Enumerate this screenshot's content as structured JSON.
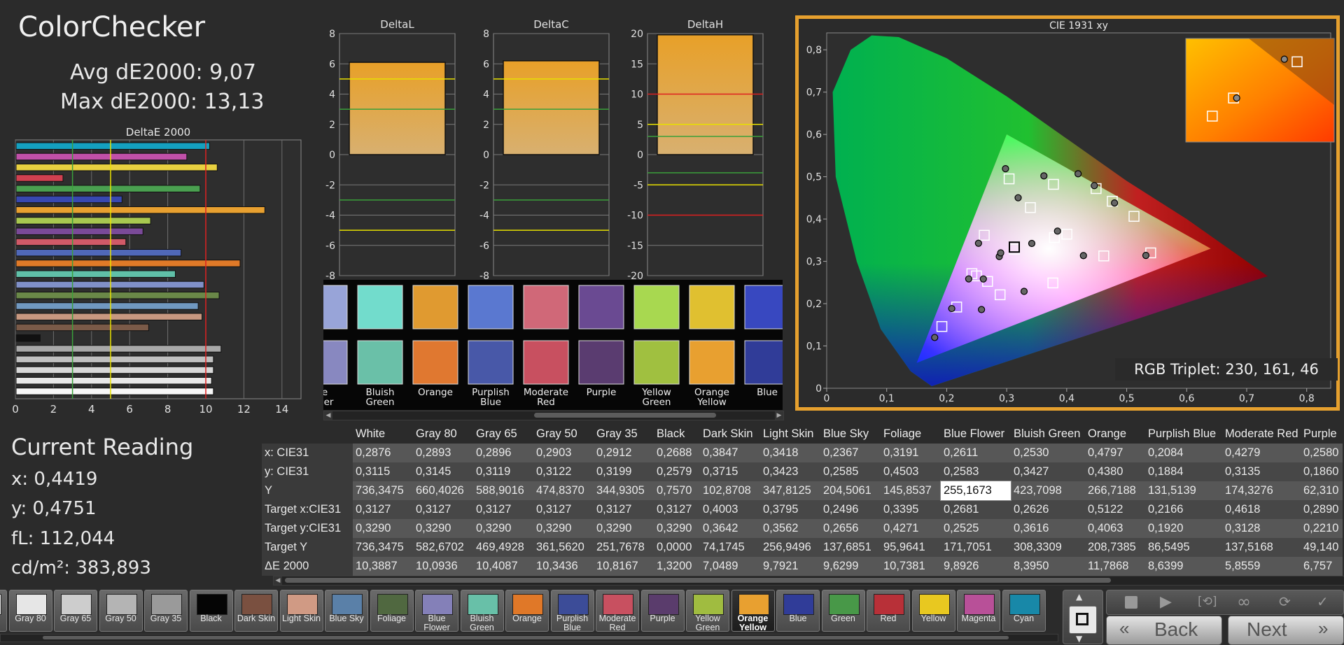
{
  "header": {
    "title": "ColorChecker",
    "avg_label": "Avg dE2000:",
    "avg_value": "9,07",
    "max_label": "Max dE2000:",
    "max_value": "13,13"
  },
  "current_reading": {
    "title": "Current Reading",
    "x_label": "x:",
    "x": "0,4419",
    "y_label": "y:",
    "y": "0,4751",
    "fl_label": "fL:",
    "fl": "112,044",
    "cd_label": "cd/m²:",
    "cd": "383,893"
  },
  "colors": {
    "accent": "#e6a02e",
    "panel": "#2b2b2b",
    "grid_line": "#777777",
    "green_line": "#3aa03a",
    "yellow_line": "#e8e000",
    "red_line": "#dd2020"
  },
  "deltae_chart": {
    "title": "DeltaE 2000",
    "x_ticks": [
      "0",
      "2",
      "4",
      "6",
      "8",
      "10",
      "12",
      "14"
    ],
    "xlim": [
      0,
      15
    ],
    "threshold_lines": [
      3,
      5,
      10
    ],
    "bars": [
      {
        "value": 10.2,
        "color": "#14a0c0"
      },
      {
        "value": 9.0,
        "color": "#c050a8"
      },
      {
        "value": 10.6,
        "color": "#e8d040"
      },
      {
        "value": 2.5,
        "color": "#d04050"
      },
      {
        "value": 9.7,
        "color": "#4aa050"
      },
      {
        "value": 5.6,
        "color": "#3848b0"
      },
      {
        "value": 13.1,
        "color": "#e8a030"
      },
      {
        "value": 7.1,
        "color": "#a8c850"
      },
      {
        "value": 6.7,
        "color": "#7a4a98"
      },
      {
        "value": 5.8,
        "color": "#d05a68"
      },
      {
        "value": 8.7,
        "color": "#5068b8"
      },
      {
        "value": 11.8,
        "color": "#e07a28"
      },
      {
        "value": 8.4,
        "color": "#60c0a8"
      },
      {
        "value": 9.9,
        "color": "#8090c8"
      },
      {
        "value": 10.7,
        "color": "#6a8848"
      },
      {
        "value": 9.6,
        "color": "#7098c0"
      },
      {
        "value": 9.8,
        "color": "#c89880"
      },
      {
        "value": 7.0,
        "color": "#7a5a48"
      },
      {
        "value": 1.3,
        "color": "#111111"
      },
      {
        "value": 10.8,
        "color": "#a8a8a8"
      },
      {
        "value": 10.4,
        "color": "#c0c0c0"
      },
      {
        "value": 10.4,
        "color": "#d8d8d8"
      },
      {
        "value": 10.3,
        "color": "#e8e8e8"
      },
      {
        "value": 10.4,
        "color": "#f8f8f8"
      }
    ]
  },
  "delta_charts": [
    {
      "title": "DeltaL",
      "ticks": [
        "8",
        "6",
        "4",
        "2",
        "0",
        "-2",
        "-4",
        "-6",
        "-8"
      ],
      "ylim": [
        -8,
        8
      ],
      "value": 6.1,
      "lines": [
        {
          "v": 5,
          "c": "yellow"
        },
        {
          "v": 3,
          "c": "green"
        },
        {
          "v": -3,
          "c": "green"
        },
        {
          "v": -5,
          "c": "yellow"
        }
      ]
    },
    {
      "title": "DeltaC",
      "ticks": [
        "8",
        "6",
        "4",
        "2",
        "0",
        "-2",
        "-4",
        "-6",
        "-8"
      ],
      "ylim": [
        -8,
        8
      ],
      "value": 6.2,
      "lines": [
        {
          "v": 5,
          "c": "yellow"
        },
        {
          "v": 3,
          "c": "green"
        },
        {
          "v": -3,
          "c": "green"
        },
        {
          "v": -5,
          "c": "yellow"
        }
      ]
    },
    {
      "title": "DeltaH",
      "ticks": [
        "20",
        "15",
        "10",
        "5",
        "0",
        "-5",
        "-10",
        "-15",
        "-20"
      ],
      "ylim": [
        -20,
        20
      ],
      "value": 19.8,
      "lines": [
        {
          "v": 10,
          "c": "red"
        },
        {
          "v": 5,
          "c": "yellow"
        },
        {
          "v": 3,
          "c": "green"
        },
        {
          "v": -3,
          "c": "green"
        },
        {
          "v": -5,
          "c": "yellow"
        },
        {
          "v": -10,
          "c": "red"
        }
      ]
    }
  ],
  "swatch_panel": {
    "labels": [
      "e\nwer",
      "Bluish\nGreen",
      "Orange",
      "Purplish\nBlue",
      "Moderate\nRed",
      "Purple",
      "Yellow\nGreen",
      "Orange\nYellow",
      "Blue"
    ],
    "measured": [
      "#98a4d8",
      "#72dccc",
      "#e09a30",
      "#5a78d0",
      "#d06878",
      "#6a4a92",
      "#a8d850",
      "#e0c030",
      "#3848c0"
    ],
    "target": [
      "#8888c0",
      "#6ac0a8",
      "#e07830",
      "#4858a8",
      "#c85060",
      "#5a3c70",
      "#a0c040",
      "#e8a030",
      "#303c98"
    ]
  },
  "cie_chart": {
    "title": "CIE 1931 xy",
    "x_ticks": [
      "0",
      "0,1",
      "0,2",
      "0,3",
      "0,4",
      "0,5",
      "0,6",
      "0,7",
      "0,8"
    ],
    "y_ticks": [
      "0",
      "0,1",
      "0,2",
      "0,3",
      "0,4",
      "0,5",
      "0,6",
      "0,7",
      "0,8"
    ],
    "xlim": [
      0,
      0.84
    ],
    "ylim": [
      0,
      0.84
    ],
    "gamut_triangle": [
      [
        0.64,
        0.33
      ],
      [
        0.3,
        0.6
      ],
      [
        0.15,
        0.06
      ]
    ],
    "targets": [
      [
        0.3127,
        0.329
      ],
      [
        0.4003,
        0.3642
      ],
      [
        0.3795,
        0.3562
      ],
      [
        0.2496,
        0.2656
      ],
      [
        0.3395,
        0.4271
      ],
      [
        0.2681,
        0.2525
      ],
      [
        0.2626,
        0.3616
      ],
      [
        0.5122,
        0.4063
      ],
      [
        0.2166,
        0.192
      ],
      [
        0.4618,
        0.3128
      ],
      [
        0.289,
        0.221
      ],
      [
        0.378,
        0.482
      ],
      [
        0.476,
        0.442
      ],
      [
        0.192,
        0.146
      ],
      [
        0.304,
        0.495
      ],
      [
        0.54,
        0.32
      ],
      [
        0.449,
        0.472
      ],
      [
        0.377,
        0.249
      ],
      [
        0.242,
        0.271
      ]
    ],
    "measured": [
      [
        0.2876,
        0.3115
      ],
      [
        0.3847,
        0.3715
      ],
      [
        0.3418,
        0.3423
      ],
      [
        0.2367,
        0.2585
      ],
      [
        0.3191,
        0.4503
      ],
      [
        0.2611,
        0.2583
      ],
      [
        0.253,
        0.3427
      ],
      [
        0.4797,
        0.438
      ],
      [
        0.2084,
        0.1884
      ],
      [
        0.4279,
        0.3135
      ],
      [
        0.258,
        0.186
      ],
      [
        0.362,
        0.502
      ],
      [
        0.446,
        0.479
      ],
      [
        0.18,
        0.12
      ],
      [
        0.298,
        0.519
      ],
      [
        0.532,
        0.314
      ],
      [
        0.419,
        0.507
      ],
      [
        0.329,
        0.229
      ],
      [
        0.29,
        0.32
      ]
    ],
    "current": [
      0.3127,
      0.3336
    ],
    "inset_targets": [
      [
        0.585,
        0.812
      ],
      [
        0.525,
        0.784
      ],
      [
        0.505,
        0.77
      ]
    ],
    "inset_measured": [
      [
        0.573,
        0.814
      ],
      [
        0.528,
        0.784
      ]
    ]
  },
  "rgb_triplet": {
    "label": "RGB Triplet:",
    "value": "230, 161, 46"
  },
  "table": {
    "row_header_blank": "",
    "columns": [
      "White",
      "Gray 80",
      "Gray 65",
      "Gray 50",
      "Gray 35",
      "Black",
      "Dark Skin",
      "Light Skin",
      "Blue Sky",
      "Foliage",
      "Blue Flower",
      "Bluish Green",
      "Orange",
      "Purplish Blue",
      "Moderate Red",
      "Purple"
    ],
    "rows": [
      {
        "label": "x: CIE31",
        "cells": [
          "0,2876",
          "0,2893",
          "0,2896",
          "0,2903",
          "0,2912",
          "0,2688",
          "0,3847",
          "0,3418",
          "0,2367",
          "0,3191",
          "0,2611",
          "0,2530",
          "0,4797",
          "0,2084",
          "0,4279",
          "0,2580"
        ]
      },
      {
        "label": "y: CIE31",
        "cells": [
          "0,3115",
          "0,3145",
          "0,3119",
          "0,3122",
          "0,3199",
          "0,2579",
          "0,3715",
          "0,3423",
          "0,2585",
          "0,4503",
          "0,2583",
          "0,3427",
          "0,4380",
          "0,1884",
          "0,3135",
          "0,1860"
        ]
      },
      {
        "label": "Y",
        "cells": [
          "736,3475",
          "660,4026",
          "588,9016",
          "474,8370",
          "344,9305",
          "0,7570",
          "102,8708",
          "347,8125",
          "204,5061",
          "145,8537",
          "255,1673",
          "423,7098",
          "266,7188",
          "131,5139",
          "174,3276",
          "62,310"
        ]
      },
      {
        "label": "Target x:CIE31",
        "cells": [
          "0,3127",
          "0,3127",
          "0,3127",
          "0,3127",
          "0,3127",
          "0,3127",
          "0,4003",
          "0,3795",
          "0,2496",
          "0,3395",
          "0,2681",
          "0,2626",
          "0,5122",
          "0,2166",
          "0,4618",
          "0,2890"
        ]
      },
      {
        "label": "Target y:CIE31",
        "cells": [
          "0,3290",
          "0,3290",
          "0,3290",
          "0,3290",
          "0,3290",
          "0,3290",
          "0,3642",
          "0,3562",
          "0,2656",
          "0,4271",
          "0,2525",
          "0,3616",
          "0,4063",
          "0,1920",
          "0,3128",
          "0,2210"
        ]
      },
      {
        "label": "Target Y",
        "cells": [
          "736,3475",
          "582,6702",
          "469,4928",
          "361,5620",
          "251,7678",
          "0,0000",
          "74,1745",
          "256,9496",
          "137,6851",
          "95,9641",
          "171,7051",
          "308,3309",
          "208,7385",
          "86,5495",
          "137,5168",
          "49,140"
        ]
      },
      {
        "label": "ΔE 2000",
        "cells": [
          "10,3887",
          "10,0936",
          "10,4087",
          "10,3436",
          "10,8167",
          "1,3200",
          "7,0489",
          "9,7921",
          "9,6299",
          "10,7381",
          "9,8926",
          "8,3950",
          "11,7868",
          "8,6399",
          "5,8559",
          "6,757"
        ]
      }
    ]
  },
  "patch_strip": {
    "tabs": [
      {
        "label": "e",
        "color": "#f4f4f4"
      },
      {
        "label": "Gray 80",
        "color": "#e6e6e6"
      },
      {
        "label": "Gray 65",
        "color": "#cdcdcd"
      },
      {
        "label": "Gray 50",
        "color": "#b4b4b4"
      },
      {
        "label": "Gray 35",
        "color": "#9a9a9a"
      },
      {
        "label": "Black",
        "color": "#050505"
      },
      {
        "label": "Dark Skin",
        "color": "#7a5040"
      },
      {
        "label": "Light Skin",
        "color": "#d09a84"
      },
      {
        "label": "Blue Sky",
        "color": "#5a80a8"
      },
      {
        "label": "Foliage",
        "color": "#506840"
      },
      {
        "label": "Blue\nFlower",
        "color": "#8480b8"
      },
      {
        "label": "Bluish\nGreen",
        "color": "#68c0a8"
      },
      {
        "label": "Orange",
        "color": "#e07828"
      },
      {
        "label": "Purplish\nBlue",
        "color": "#3c4c98"
      },
      {
        "label": "Moderate\nRed",
        "color": "#c85060"
      },
      {
        "label": "Purple",
        "color": "#5a3c6c"
      },
      {
        "label": "Yellow\nGreen",
        "color": "#a0bc40"
      },
      {
        "label": "Orange\nYellow",
        "color": "#e8a030",
        "active": true
      },
      {
        "label": "Blue",
        "color": "#303c98"
      },
      {
        "label": "Green",
        "color": "#489848"
      },
      {
        "label": "Red",
        "color": "#b83038"
      },
      {
        "label": "Yellow",
        "color": "#e8c820"
      },
      {
        "label": "Magenta",
        "color": "#b85098"
      },
      {
        "label": "Cyan",
        "color": "#1888a8"
      }
    ]
  },
  "nav": {
    "back_label": "Back",
    "next_label": "Next"
  },
  "icons": {
    "stop": "stop-icon",
    "play": "play-icon",
    "single": "single-read-icon",
    "loop": "loop-icon",
    "auto": "auto-icon",
    "check": "check-icon",
    "up": "arrow-up-icon",
    "down": "arrow-down-icon",
    "record": "record-icon",
    "back_chevron": "double-chevron-left-icon",
    "next_chevron": "double-chevron-right-icon"
  }
}
